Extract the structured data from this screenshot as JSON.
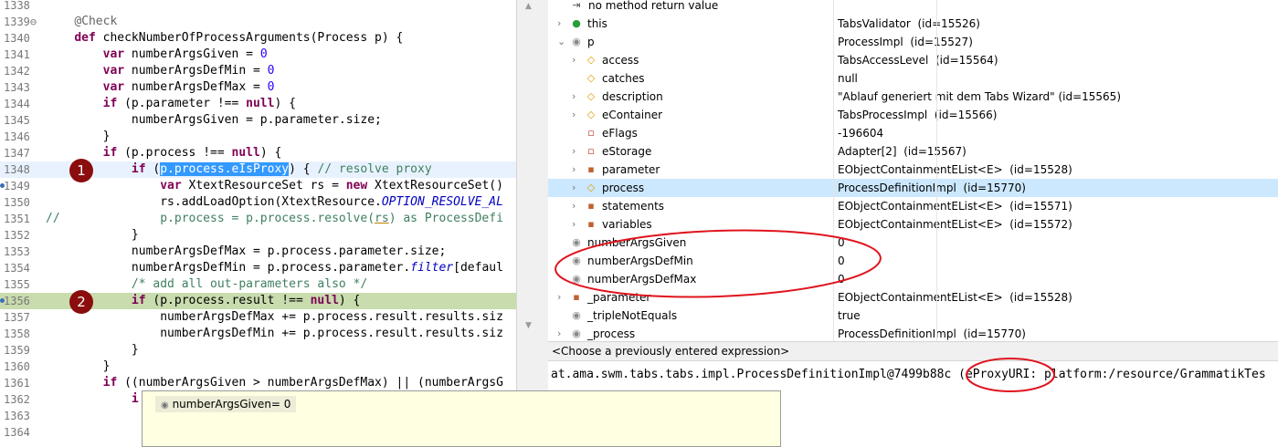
{
  "editor": {
    "lines": [
      {
        "n": "1338",
        "code": ""
      },
      {
        "n": "1339⊖",
        "code": "    <span class='ann'>@Check</span>"
      },
      {
        "n": "1340",
        "code": "    <span class='kw'>def</span> checkNumberOfProcessArguments(Process p) {"
      },
      {
        "n": "1341",
        "code": "        <span class='kw'>var</span> numberArgsGiven = <span class='lit'>0</span>"
      },
      {
        "n": "1342",
        "code": "        <span class='kw'>var</span> numberArgsDefMin = <span class='lit'>0</span>"
      },
      {
        "n": "1343",
        "code": "        <span class='kw'>var</span> numberArgsDefMax = <span class='lit'>0</span>"
      },
      {
        "n": "1344",
        "code": "        <span class='kw'>if</span> (p.parameter !== <span class='kw'>null</span>) {"
      },
      {
        "n": "1345",
        "code": "            numberArgsGiven = p.parameter.size;"
      },
      {
        "n": "1346",
        "code": "        }"
      },
      {
        "n": "1347",
        "code": "        <span class='kw'>if</span> (p.process !== <span class='kw'>null</span>) {"
      },
      {
        "n": "1348",
        "code": "            <span class='kw'>if</span> (<span class='sel'>p.process.eIsProxy</span>) { <span class='cm'>// resolve proxy</span>"
      },
      {
        "n": "1349",
        "code": "                <span class='kw'>var</span> XtextResourceSet rs = <span class='kw'>new</span> XtextResourceSet()"
      },
      {
        "n": "1350",
        "code": "                rs.addLoadOption(XtextResource.<span class='it'>OPTION_RESOLVE_AL</span>"
      },
      {
        "n": "1351",
        "code": "<span class='cm'>//              p.process = p.process.resolve(<span class='ul'>rs</span>) as ProcessDefi</span>"
      },
      {
        "n": "1352",
        "code": "            }"
      },
      {
        "n": "1353",
        "code": "            numberArgsDefMax = p.process.parameter.size;"
      },
      {
        "n": "1354",
        "code": "            numberArgsDefMin = p.process.parameter.<span class='it'>filter</span>[defaul"
      },
      {
        "n": "1355",
        "code": "            <span class='cm'>/* add all out-parameters also */</span>"
      },
      {
        "n": "1356",
        "code": "            <span class='kw'>if</span> (p.process.result !== <span class='kw'>null</span>) {"
      },
      {
        "n": "1357",
        "code": "                numberArgsDefMax += p.process.result.results.siz"
      },
      {
        "n": "1358",
        "code": "                numberArgsDefMin += p.process.result.results.siz"
      },
      {
        "n": "1359",
        "code": "            }"
      },
      {
        "n": "1360",
        "code": "        }"
      },
      {
        "n": "1361",
        "code": "        <span class='kw'>if</span> ((numberArgsGiven &gt; numberArgsDefMax) || (numberArgsG"
      },
      {
        "n": "1362",
        "code": "            <span class='kw'>i</span>"
      },
      {
        "n": "1363",
        "code": ""
      },
      {
        "n": "1364",
        "code": ""
      }
    ],
    "badges": [
      "1",
      "2"
    ]
  },
  "tooltip": {
    "text": "numberArgsGiven= 0"
  },
  "variables": {
    "top_row": "no method return value",
    "rows": [
      {
        "name": "this",
        "value": "TabsValidator  (id=15526)"
      },
      {
        "name": "p",
        "value": "ProcessImpl  (id=15527)"
      },
      {
        "name": "access",
        "value": "TabsAccessLevel  (id=15564)"
      },
      {
        "name": "catches",
        "value": "null"
      },
      {
        "name": "description",
        "value": "\"Ablauf generiert mit dem Tabs Wizard\" (id=15565)"
      },
      {
        "name": "eContainer",
        "value": "TabsProcessImpl  (id=15566)"
      },
      {
        "name": "eFlags",
        "value": "-196604"
      },
      {
        "name": "eStorage",
        "value": "Adapter[2]  (id=15567)"
      },
      {
        "name": "parameter",
        "value": "EObjectContainmentEList<E>  (id=15528)"
      },
      {
        "name": "process",
        "value": "ProcessDefinitionImpl  (id=15770)"
      },
      {
        "name": "statements",
        "value": "EObjectContainmentEList<E>  (id=15571)"
      },
      {
        "name": "variables",
        "value": "EObjectContainmentEList<E>  (id=15572)"
      },
      {
        "name": "numberArgsGiven",
        "value": "0"
      },
      {
        "name": "numberArgsDefMin",
        "value": "0"
      },
      {
        "name": "numberArgsDefMax",
        "value": "0"
      },
      {
        "name": "_parameter",
        "value": "EObjectContainmentEList<E>  (id=15528)"
      },
      {
        "name": "_tripleNotEquals",
        "value": "true"
      },
      {
        "name": "_process",
        "value": "ProcessDefinitionImpl  (id=15770)"
      }
    ]
  },
  "expression": {
    "prompt": "<Choose a previously entered expression>"
  },
  "detail": {
    "text": "at.ama.swm.tabs.tabs.impl.ProcessDefinitionImpl@7499b88c (eProxyURI: platform:/resource/GrammatikTes"
  }
}
